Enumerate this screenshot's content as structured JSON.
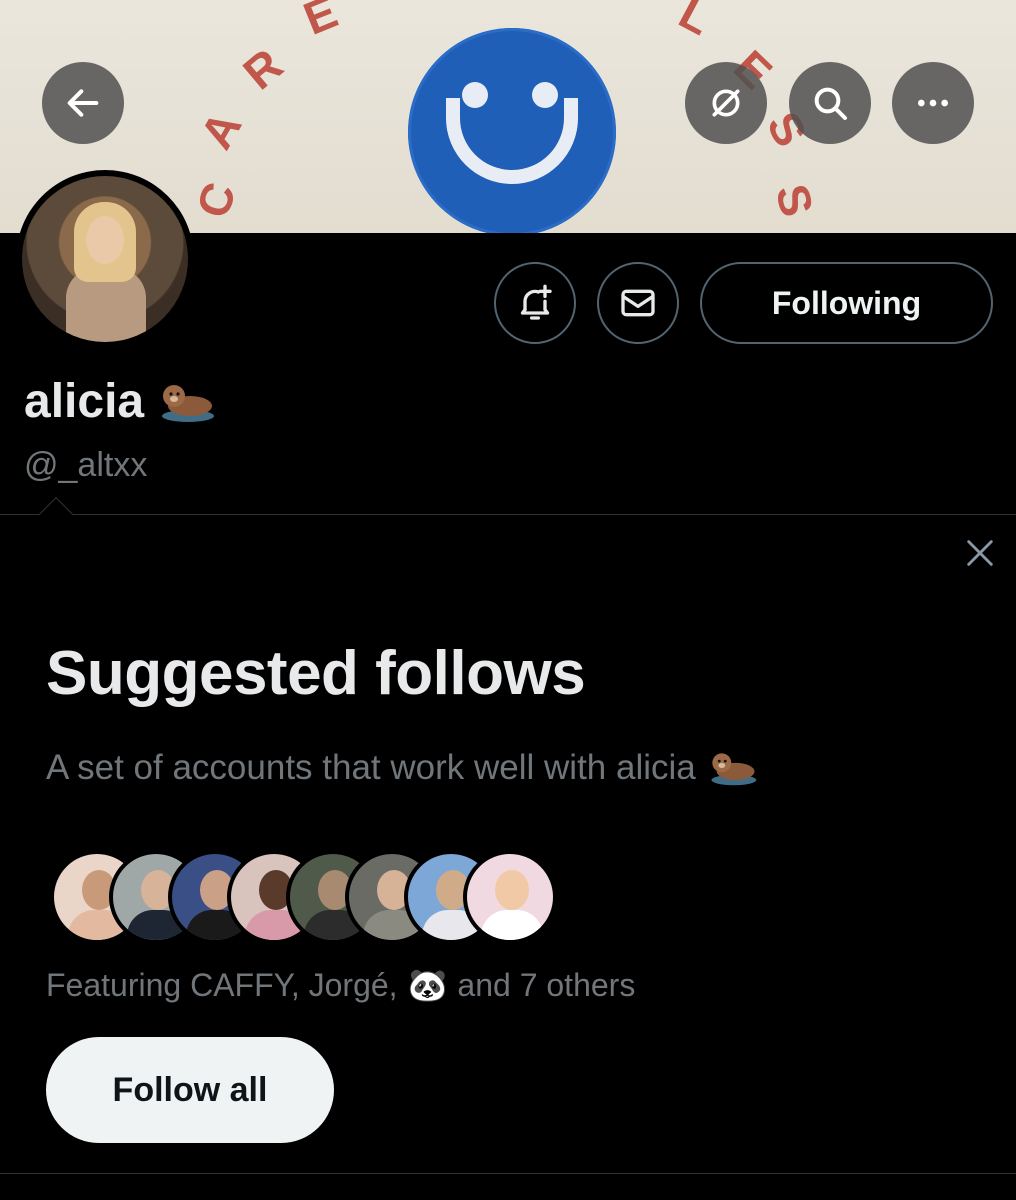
{
  "header": {
    "banner_letters_left": "CARE",
    "banner_letters_right": "LESS",
    "icons": {
      "back": "arrow-left-icon",
      "hide": "eye-slash-icon",
      "search": "search-icon",
      "more": "more-horizontal-icon"
    }
  },
  "profile": {
    "display_name": "alicia",
    "name_emoji": "otter",
    "handle": "@_altxx",
    "actions": {
      "notify_icon": "bell-plus-icon",
      "message_icon": "envelope-icon",
      "following_label": "Following"
    }
  },
  "suggested": {
    "title": "Suggested follows",
    "subtitle": "A set of accounts that work well with alicia",
    "featuring_prefix": "Featuring CAFFY, Jorgé,",
    "featuring_emoji": "🐼",
    "featuring_suffix": "and 7 others",
    "follow_all_label": "Follow all",
    "avatars": [
      {
        "name": "avatar-1",
        "bg": "#e9d6c8",
        "head": "#c99a7a",
        "torso": "#e3b9a0"
      },
      {
        "name": "avatar-2",
        "bg": "#9fa8a6",
        "head": "#d7b39a",
        "torso": "#1d2632"
      },
      {
        "name": "avatar-3",
        "bg": "#3a4f86",
        "head": "#caa086",
        "torso": "#1a1a1a"
      },
      {
        "name": "avatar-4",
        "bg": "#d9c3bd",
        "head": "#5a3a2a",
        "torso": "#d89aa8"
      },
      {
        "name": "avatar-5",
        "bg": "#4f5a4a",
        "head": "#a88a70",
        "torso": "#2c2c2c"
      },
      {
        "name": "avatar-6",
        "bg": "#6b6b66",
        "head": "#d6b296",
        "torso": "#8a8a80"
      },
      {
        "name": "avatar-7",
        "bg": "#7da7d6",
        "head": "#d0ab8a",
        "torso": "#e8e8ec"
      },
      {
        "name": "avatar-8",
        "bg": "#f1d9e2",
        "head": "#f2c9a6",
        "torso": "#ffffff"
      }
    ]
  },
  "colors": {
    "background": "#000000",
    "secondary_text": "#71767b",
    "border": "#536471",
    "primary_button": "#eff3f4",
    "banner_blue": "#1f5fb8",
    "banner_red": "#c0574a"
  }
}
